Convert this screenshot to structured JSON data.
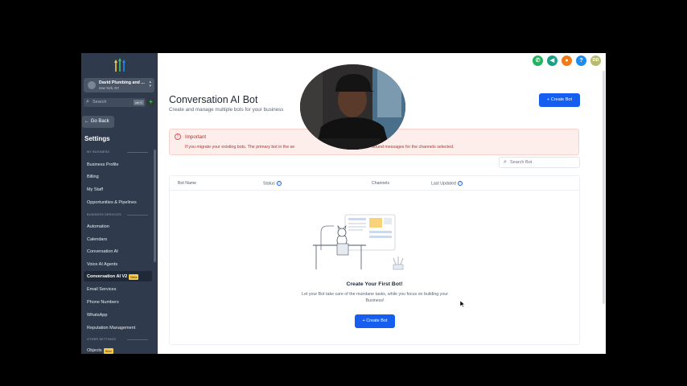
{
  "sidebar": {
    "account_name": "David Plumbing and ...",
    "account_location": "new York, NY",
    "search_placeholder": "Search",
    "search_shortcut": "ctrl K",
    "quick_add": "+",
    "go_back": "Go Back",
    "settings_title": "Settings",
    "sections": {
      "my_business": "MY BUSINESS",
      "business_services": "BUSINESS SERVICES",
      "other_settings": "OTHER SETTINGS"
    },
    "items": {
      "business_profile": "Business Profile",
      "billing": "Billing",
      "my_staff": "My Staff",
      "opportunities": "Opportunities & Pipelines",
      "automation": "Automation",
      "calendars": "Calendars",
      "conversation_ai": "Conversation AI",
      "voice_ai_agents": "Voice AI Agents",
      "conversation_ai_v2": "Conversation AI V2",
      "conversation_ai_v2_badge": "Beta",
      "email_services": "Email Services",
      "phone_numbers": "Phone Numbers",
      "whatsapp": "WhatsApp",
      "reputation_management": "Reputation Management",
      "objects": "Objects",
      "objects_badge": "New"
    }
  },
  "header": {
    "avatar_initials": "DD",
    "help": "?"
  },
  "main": {
    "title": "Conversation AI Bot",
    "subtitle": "Create and manage multiple bots for your business",
    "create_bot_label": "+ Create Bot",
    "alert": {
      "title": "Important",
      "body_start": "If you migrate your existing bots, The primary bot in the se",
      "body_end": "bound messages for the channels selected."
    },
    "search_placeholder": "Search Bot",
    "table": {
      "columns": {
        "bot_name": "Bot Name",
        "status": "Status",
        "channels": "Channels",
        "last_updated": "Last Updated"
      },
      "help_icon_text": "?"
    },
    "empty": {
      "title": "Create Your First Bot!",
      "description": "Let your Bot take care of the mundane tasks, while you focus on building your Business!",
      "button": "+ Create Bot"
    }
  },
  "colors": {
    "sidebar_bg": "#2f3b4c",
    "primary": "#155eef",
    "alert_bg": "#fdeeec",
    "alert_text": "#b4332b",
    "badge": "#f7c948"
  }
}
